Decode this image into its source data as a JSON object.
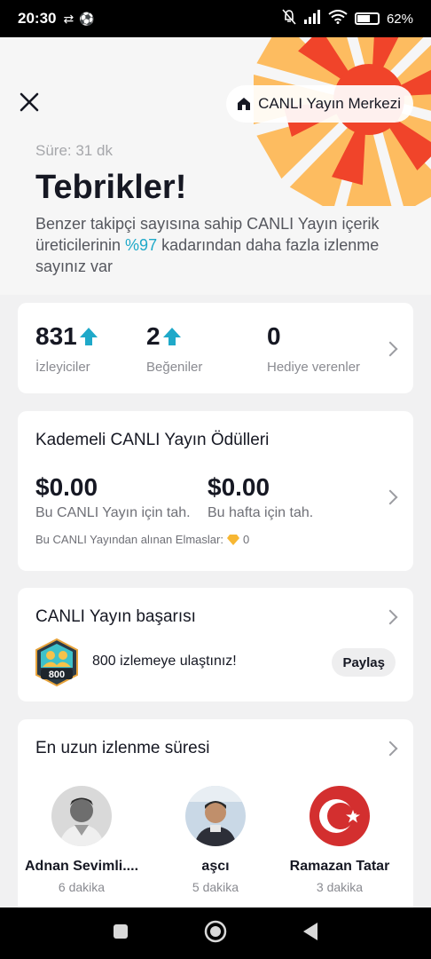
{
  "status_bar": {
    "time": "20:30",
    "battery": "62%",
    "battery_level": 0.62
  },
  "header": {
    "live_center_label": "CANLI Yayın Merkezi"
  },
  "summary": {
    "duration": "Süre: 31 dk",
    "title": "Tebrikler!",
    "desc_before": "Benzer takipçi sayısına sahip CANLI Yayın içerik üreticilerinin ",
    "desc_percent": "%97",
    "desc_after": " kadarından daha fazla izlenme sayınız var"
  },
  "stats": [
    {
      "value": "831",
      "label": "İzleyiciler",
      "trend": "up"
    },
    {
      "value": "2",
      "label": "Beğeniler",
      "trend": "up"
    },
    {
      "value": "0",
      "label": "Hediye verenler",
      "trend": "none"
    }
  ],
  "rewards": {
    "title": "Kademeli CANLI Yayın Ödülleri",
    "live_amount": "$0.00",
    "live_label": "Bu CANLI Yayın için tah.",
    "week_amount": "$0.00",
    "week_label": "Bu hafta için tah.",
    "diamonds_label": "Bu CANLI Yayından alınan Elmaslar:",
    "diamonds_value": "0"
  },
  "success": {
    "title": "CANLI Yayın başarısı",
    "badge_number": "800",
    "message": "800 izlemeye ulaştınız!",
    "share_label": "Paylaş"
  },
  "watch_time": {
    "title": "En uzun izlenme süresi",
    "viewers": [
      {
        "name": "Adnan Sevimli....",
        "duration": "6 dakika"
      },
      {
        "name": "aşcı",
        "duration": "5 dakika"
      },
      {
        "name": "Ramazan Tatar",
        "duration": "3 dakika"
      }
    ]
  },
  "colors": {
    "accent": "#1fa9c9",
    "burst_red": "#f0442a",
    "burst_orange": "#ffb347"
  }
}
